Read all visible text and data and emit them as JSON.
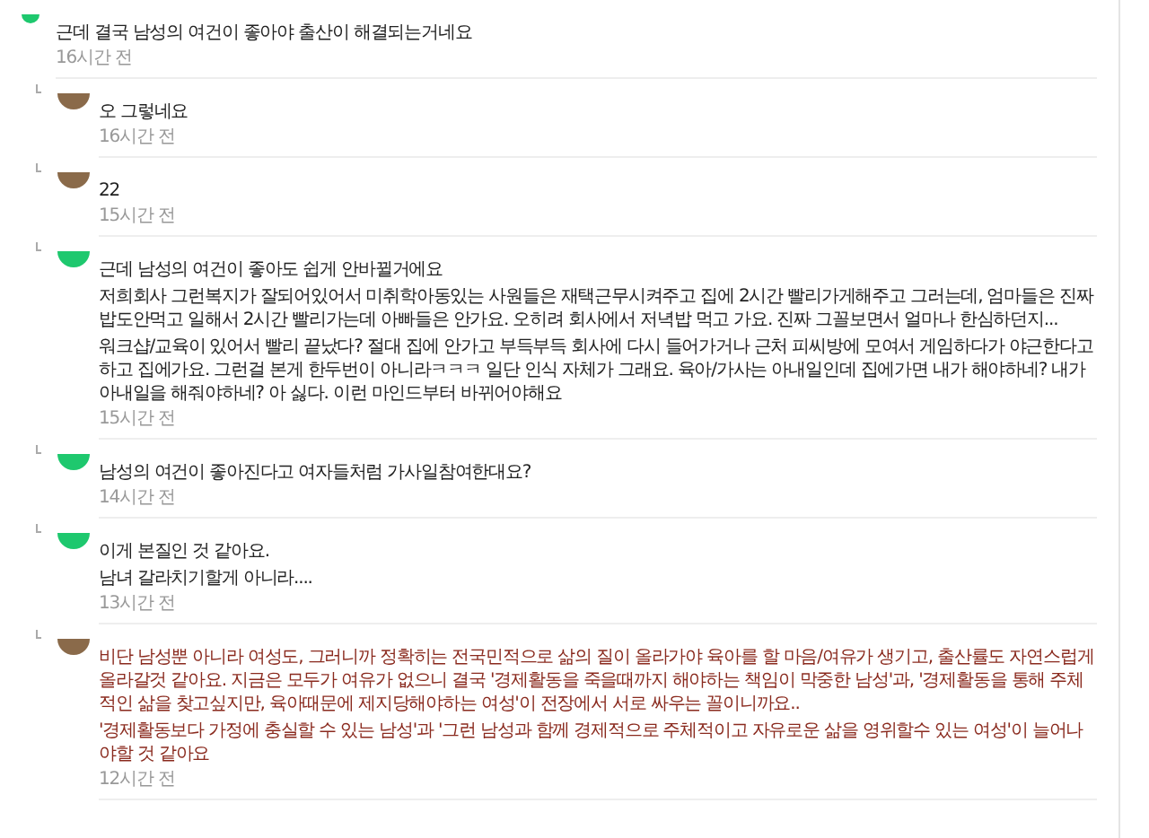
{
  "comment": {
    "kind": "plain",
    "author_highlight": false,
    "paragraphs": [
      "근데 결국 남성의 여건이 좋아야 출산이 해결되는거네요"
    ],
    "time": "16시간 전",
    "replies": [
      {
        "kind": "photo",
        "author_highlight": false,
        "paragraphs": [
          "오 그렇네요"
        ],
        "time": "16시간 전"
      },
      {
        "kind": "photo",
        "author_highlight": false,
        "paragraphs": [
          "22"
        ],
        "time": "15시간 전"
      },
      {
        "kind": "plain",
        "author_highlight": false,
        "paragraphs": [
          "근데 남성의 여건이 좋아도 쉽게 안바뀔거에요",
          "저희회사 그런복지가 잘되어있어서 미취학아동있는 사원들은 재택근무시켜주고 집에 2시간 빨리가게해주고 그러는데, 엄마들은 진짜 밥도안먹고 일해서 2시간 빨리가는데 아빠들은 안가요. 오히려 회사에서 저녁밥 먹고 가요. 진짜 그꼴보면서 얼마나 한심하던지...",
          "워크샵/교육이 있어서 빨리 끝났다? 절대 집에 안가고 부득부득 회사에 다시 들어가거나 근처 피씨방에 모여서 게임하다가 야근한다고 하고 집에가요. 그런걸 본게 한두번이 아니라ㅋㅋㅋ 일단 인식 자체가 그래요. 육아/가사는 아내일인데 집에가면 내가 해야하네? 내가 아내일을 해줘야하네? 아 싫다. 이런 마인드부터 바뀌어야해요"
        ],
        "time": "15시간 전"
      },
      {
        "kind": "plain",
        "author_highlight": false,
        "paragraphs": [
          "남성의 여건이 좋아진다고 여자들처럼 가사일참여한대요?"
        ],
        "time": "14시간 전"
      },
      {
        "kind": "plain",
        "author_highlight": false,
        "paragraphs": [
          "이게 본질인 것 같아요.",
          "남녀 갈라치기할게 아니라...."
        ],
        "time": "13시간 전"
      },
      {
        "kind": "photo",
        "author_highlight": true,
        "paragraphs": [
          "비단 남성뿐 아니라 여성도, 그러니까 정확히는 전국민적으로 삶의 질이 올라가야 육아를 할 마음/여유가 생기고, 출산률도 자연스럽게 올라갈것 같아요. 지금은 모두가 여유가 없으니 결국 '경제활동을 죽을때까지 해야하는 책임이 막중한 남성'과, '경제활동을 통해 주체적인 삶을 찾고싶지만, 육아때문에 제지당해야하는 여성'이 전장에서 서로 싸우는 꼴이니까요..",
          "'경제활동보다 가정에 충실할 수 있는 남성'과 '그런 남성과 함께 경제적으로 주체적이고 자유로운 삶을 영위할수 있는 여성'이 늘어나야할 것 같아요"
        ],
        "time": "12시간 전"
      }
    ]
  }
}
